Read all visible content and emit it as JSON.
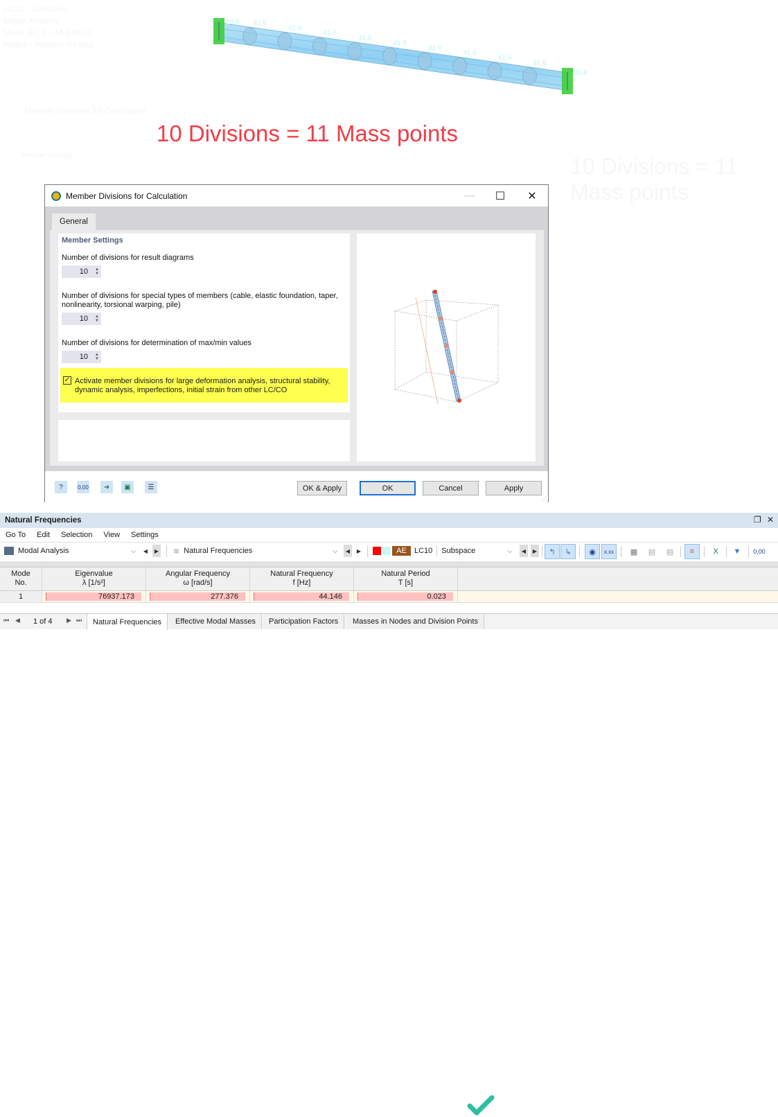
{
  "ghost_text": {
    "lines": [
      "LC10 - Subspace",
      "Modal Analysis",
      "Mode No. 1 - 44.146 Hz",
      "Nodes - Masses mx [kg]"
    ],
    "dialog_title": "Member Divisions for Calculation",
    "section": "Member Settings",
    "caption": "10 Divisions = 11 Mass points"
  },
  "beam": {
    "end_mass_labels": [
      "20.8",
      "20.8"
    ],
    "inner_mass_labels": [
      "41.6",
      "41.6",
      "41.6",
      "41.6",
      "41.6",
      "41.6",
      "41.6",
      "41.6",
      "41.6"
    ],
    "mass_points": 11,
    "colors": {
      "beam": "#9ed6f5",
      "support": "#3ccf3c",
      "label": "#bff3f5"
    }
  },
  "caption": {
    "text": "10 Divisions = 11 Mass points",
    "color": "#f03c46"
  },
  "dialog": {
    "title": "Member Divisions for Calculation",
    "icon": "app-icon",
    "controls": {
      "minimize": "—",
      "maximize": "☐",
      "close": "✕"
    },
    "tab": "General",
    "section_title": "Member Settings",
    "fields": [
      {
        "label": "Number of divisions for result diagrams",
        "value": "10"
      },
      {
        "label": "Number of divisions for special types of members (cable, elastic foundation, taper, nonlinearity, torsional warping, pile)",
        "value": "10"
      },
      {
        "label": "Number of divisions for determination of max/min values",
        "value": "10"
      }
    ],
    "checkbox": {
      "checked": true,
      "label": "Activate member divisions for large deformation analysis, structural stability, dynamic analysis, imperfections, initial strain from other LC/CO"
    },
    "footer_icons": [
      "help-icon",
      "units-icon",
      "import-icon",
      "save-icon",
      "table-icon"
    ],
    "units_icon_text": "0,00",
    "buttons": {
      "ok_apply": "OK & Apply",
      "ok": "OK",
      "cancel": "Cancel",
      "apply": "Apply"
    }
  },
  "natural_frequencies": {
    "title": "Natural Frequencies",
    "menu": [
      "Go To",
      "Edit",
      "Selection",
      "View",
      "Settings"
    ],
    "module_combo": "Modal Analysis",
    "table_combo": "Natural Frequencies",
    "lc_badge": "AE",
    "lc_badge_color": "#9b5420",
    "lc_color_swatch": "#ff0000",
    "lc_swatch2": "#c8f8f8",
    "load_case": "LC10",
    "method_combo": "Subspace",
    "units_icon_text": "0,00",
    "xxx_icon_text": "x.xx",
    "columns": [
      {
        "line1": "Mode",
        "line2": "No."
      },
      {
        "line1": "Eigenvalue",
        "line2": "λ [1/s²]"
      },
      {
        "line1": "Angular Frequency",
        "line2": "ω [rad/s]"
      },
      {
        "line1": "Natural Frequency",
        "line2": "f [Hz]"
      },
      {
        "line1": "Natural Period",
        "line2": "T [s]"
      }
    ],
    "rows": [
      {
        "mode": "1",
        "eigenvalue": "76937.173",
        "angular_frequency": "277.376",
        "natural_frequency": "44.146",
        "natural_period": "0.023"
      }
    ],
    "pager": "1 of 4",
    "tabs": [
      "Natural Frequencies",
      "Effective Modal Masses",
      "Participation Factors",
      "Masses in Nodes and Division Points"
    ],
    "active_tab": "Natural Frequencies",
    "checkmark_color": "#2fbf9f"
  }
}
